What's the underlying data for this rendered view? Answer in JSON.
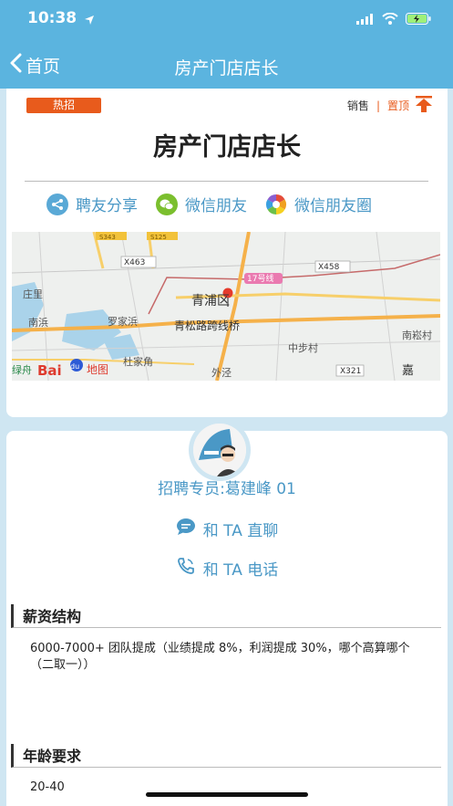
{
  "status_bar": {
    "time": "10:38"
  },
  "navbar": {
    "back_label": "首页",
    "title": "房产门店店长"
  },
  "job": {
    "hot_badge": "热招",
    "sale_label": "销售",
    "separator": "|",
    "top_label": "置顶",
    "title": "房产门店店长"
  },
  "share": [
    {
      "label": "聘友分享",
      "icon": "share-icon",
      "color": "#5aa9d6"
    },
    {
      "label": "微信朋友",
      "icon": "wechat-icon",
      "color": "#7bbf2e"
    },
    {
      "label": "微信朋友圈",
      "icon": "moments-icon",
      "color": "#e44d3a"
    }
  ],
  "map": {
    "labels": {
      "x463": "X463",
      "x458": "X458",
      "line17": "17号线",
      "qingpu": "青浦区",
      "zhuangli": "庄里",
      "nanbang": "南浜",
      "luojiabang": "罗家浜",
      "qingsong": "青松路跨线桥",
      "zhongbucun": "中步村",
      "nansongcun": "南崧村",
      "dujiajiao": "杜家角",
      "waijing": "外泾",
      "x321": "X321",
      "luzhou": "绿舟",
      "baidu": "Bai",
      "baidu_du": "du",
      "ditu": "地图",
      "jia": "嘉",
      "s343": "S343",
      "s125": "S125"
    }
  },
  "recruiter": {
    "name": "招聘专员:葛建峰 01",
    "chat_label": "和 TA 直聊",
    "call_label": "和 TA 电话"
  },
  "sections": {
    "salary": {
      "title": "薪资结构",
      "body": "6000-7000+ 团队提成（业绩提成 8%，利润提成 30%，哪个高算哪个（二取一））"
    },
    "age": {
      "title": "年龄要求",
      "body": "20-40"
    }
  },
  "colors": {
    "header": "#5bb4df",
    "accent": "#e85b1c",
    "link": "#4a98c6"
  }
}
